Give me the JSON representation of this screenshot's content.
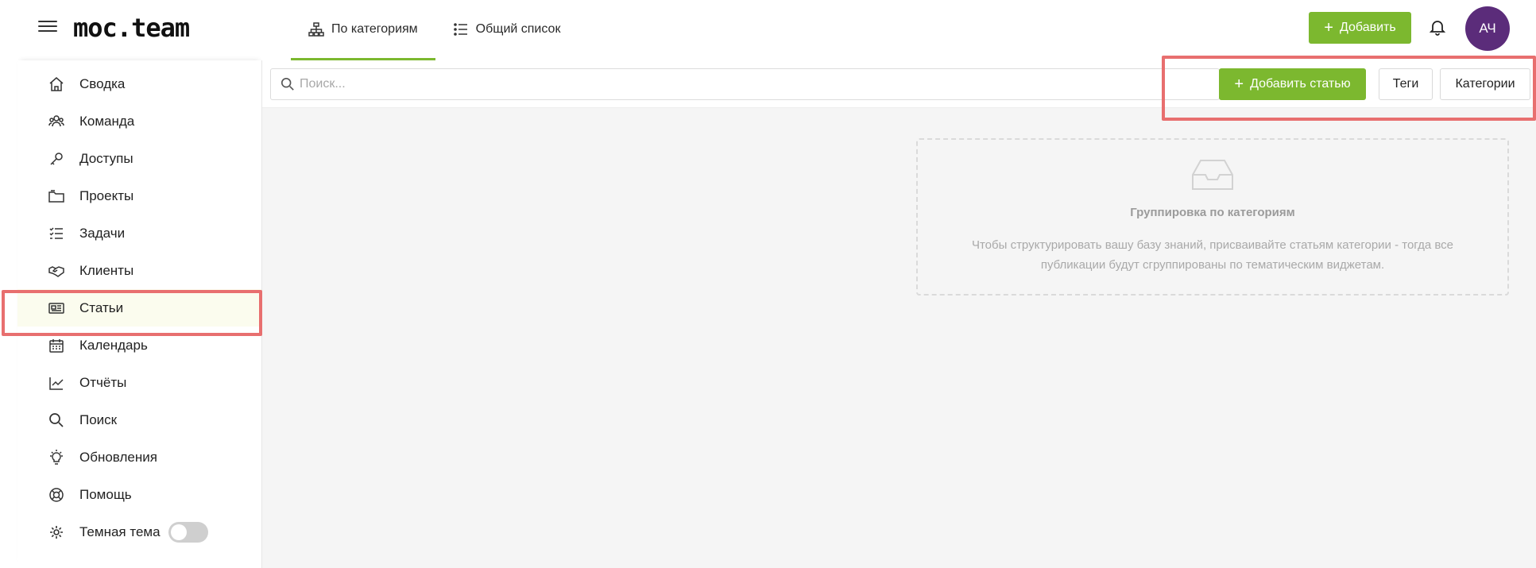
{
  "header": {
    "logo": "moc.team",
    "tabs": [
      {
        "label": "По категориям",
        "icon": "sitemap-icon",
        "active": true
      },
      {
        "label": "Общий список",
        "icon": "list-icon",
        "active": false
      }
    ],
    "add_label": "Добавить",
    "avatar_initials": "АЧ"
  },
  "sidebar": {
    "items": [
      {
        "label": "Сводка",
        "icon": "home-icon"
      },
      {
        "label": "Команда",
        "icon": "team-icon"
      },
      {
        "label": "Доступы",
        "icon": "key-icon"
      },
      {
        "label": "Проекты",
        "icon": "folder-icon"
      },
      {
        "label": "Задачи",
        "icon": "tasks-icon"
      },
      {
        "label": "Клиенты",
        "icon": "handshake-icon"
      },
      {
        "label": "Статьи",
        "icon": "newspaper-icon",
        "active": true
      },
      {
        "label": "Календарь",
        "icon": "calendar-icon"
      },
      {
        "label": "Отчёты",
        "icon": "chart-icon"
      },
      {
        "label": "Поиск",
        "icon": "search-icon"
      },
      {
        "label": "Обновления",
        "icon": "lightbulb-icon"
      },
      {
        "label": "Помощь",
        "icon": "lifebuoy-icon"
      }
    ],
    "theme_label": "Темная тема"
  },
  "toolbar": {
    "search_placeholder": "Поиск...",
    "add_article_label": "Добавить статью",
    "tags_label": "Теги",
    "categories_label": "Категории"
  },
  "empty_state": {
    "title": "Группировка по категориям",
    "text": "Чтобы структурировать вашу базу знаний, присваивайте статьям категории - тогда все публикации будут сгруппированы по тематическим виджетам."
  },
  "colors": {
    "accent": "#7cb82f",
    "avatar": "#5b2c7a",
    "highlight": "#e86f6f"
  }
}
